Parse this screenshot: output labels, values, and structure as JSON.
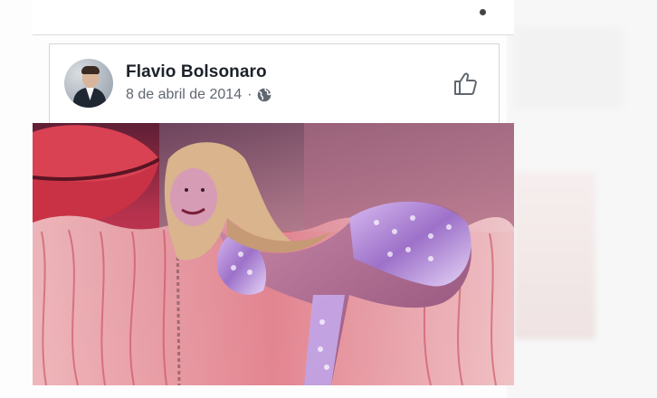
{
  "post": {
    "author": "Flavio Bolsonaro",
    "date": "8 de abril de 2014",
    "separator": "·",
    "privacy_icon": "globe-icon",
    "reaction_icon": "like-icon"
  },
  "colors": {
    "name_text": "#1d2129",
    "meta_text": "#606770",
    "icon": "#606770",
    "card_border": "#d6d6d6"
  }
}
